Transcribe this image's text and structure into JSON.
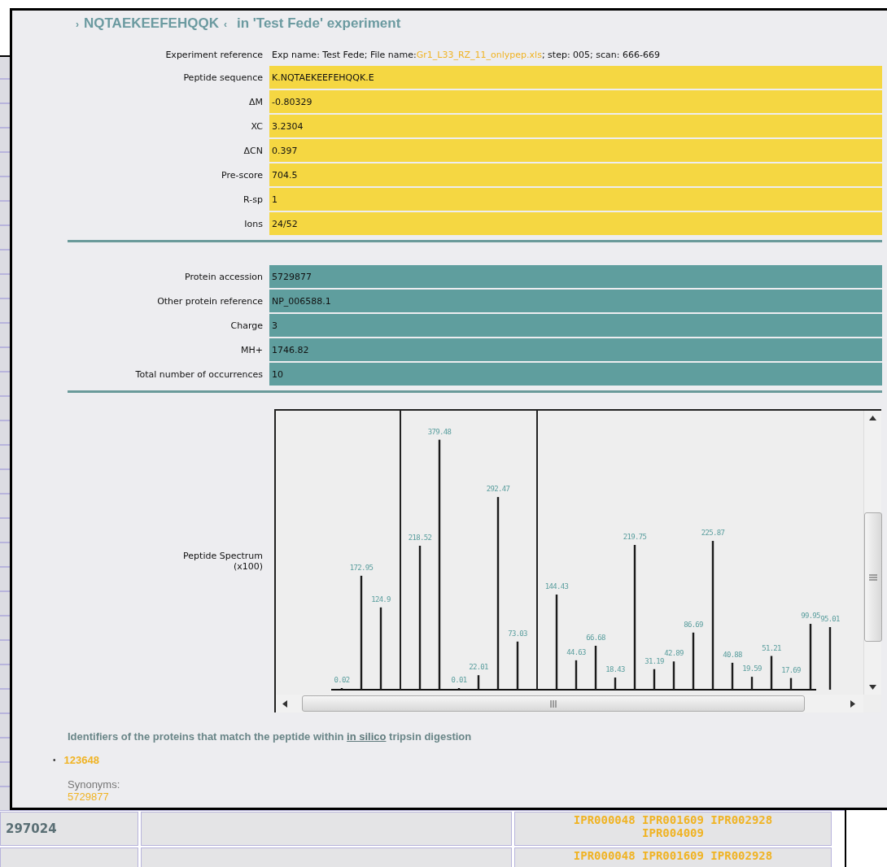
{
  "background_table": {
    "rows": [
      {
        "id": "297024",
        "domains": [
          "IPR000048 IPR001609 IPR002928",
          "IPR004009"
        ]
      },
      {
        "id": "",
        "domains": [
          "IPR000048 IPR001609 IPR002928"
        ]
      }
    ]
  },
  "dialog": {
    "title": {
      "open_mark": "›",
      "peptide": "NQTAEKEEFEHQQK",
      "close_mark": "‹",
      "experiment": "in 'Test Fede' experiment"
    },
    "experiment_reference": {
      "label": "Experiment reference",
      "prefix": "Exp name: Test Fede; File name: ",
      "file": "Gr1_L33_RZ_11_onlypep.xls",
      "suffix": "; step: 005; scan: 666-669"
    },
    "peptide_fields": [
      {
        "label": "Peptide sequence",
        "value": "K.NQTAEKEEFEHQQK.E"
      },
      {
        "label": "ΔM",
        "value": "-0.80329"
      },
      {
        "label": "XC",
        "value": "3.2304"
      },
      {
        "label": "ΔCN",
        "value": "0.397"
      },
      {
        "label": "Pre-score",
        "value": "704.5"
      },
      {
        "label": "R-sp",
        "value": "1"
      },
      {
        "label": "Ions",
        "value": "24/52"
      }
    ],
    "protein_fields": [
      {
        "label": "Protein accession",
        "value": "5729877"
      },
      {
        "label": "Other protein reference",
        "value": "NP_006588.1"
      },
      {
        "label": "Charge",
        "value": "3"
      },
      {
        "label": "MH+",
        "value": "1746.82"
      },
      {
        "label": "Total number of occurrences",
        "value": "10"
      }
    ],
    "spectrum": {
      "label": "Peptide Spectrum",
      "unit": "(x100)",
      "peak_labels": [
        "0.02",
        "172.95",
        "124.9",
        "218.52",
        "379.48",
        "0.01",
        "22.01",
        "292.47",
        "73.03",
        "144.43",
        "44.63",
        "66.68",
        "18.43",
        "219.75",
        "31.19",
        "42.89",
        "86.69",
        "225.87",
        "40.88",
        "19.59",
        "51.21",
        "17.69",
        "99.95",
        "95.01"
      ]
    },
    "identifiers": {
      "before": "Identifiers of the proteins that match the peptide within ",
      "link": "in silico",
      "after": " tripsin digestion",
      "items": [
        {
          "bullet": "•",
          "id": "123648",
          "synonyms_label": "Synonyms:",
          "synonyms": "5729877"
        }
      ]
    }
  }
}
